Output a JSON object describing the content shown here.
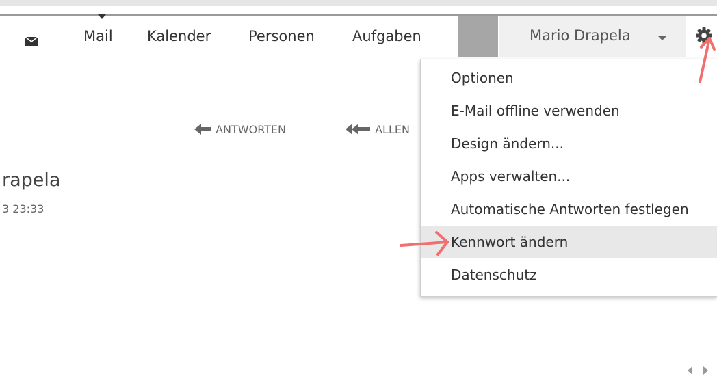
{
  "nav": {
    "items": [
      {
        "label": "Mail",
        "active": true
      },
      {
        "label": "Kalender"
      },
      {
        "label": "Personen"
      },
      {
        "label": "Aufgaben"
      }
    ],
    "user_name": "Mario Drapela",
    "mail_icon": "envelope-icon",
    "settings_icon": "gear-icon"
  },
  "toolbar": {
    "reply_label": "ANTWORTEN",
    "reply_all_label": "ALLEN"
  },
  "message": {
    "sender_fragment": "rapela",
    "timestamp_fragment": "3 23:33"
  },
  "settings_menu": {
    "items": [
      {
        "label": "Optionen"
      },
      {
        "label": "E-Mail offline verwenden"
      },
      {
        "label": "Design ändern..."
      },
      {
        "label": "Apps verwalten..."
      },
      {
        "label": "Automatische Antworten festlegen"
      },
      {
        "label": "Kennwort ändern",
        "highlighted": true
      },
      {
        "label": "Datenschutz"
      }
    ]
  },
  "colors": {
    "annotation_arrow": "#f07070",
    "highlight_row": "#e8e8e8",
    "user_area_bg": "#f0f0f0",
    "nav_gray_block": "#a6a6a6"
  }
}
